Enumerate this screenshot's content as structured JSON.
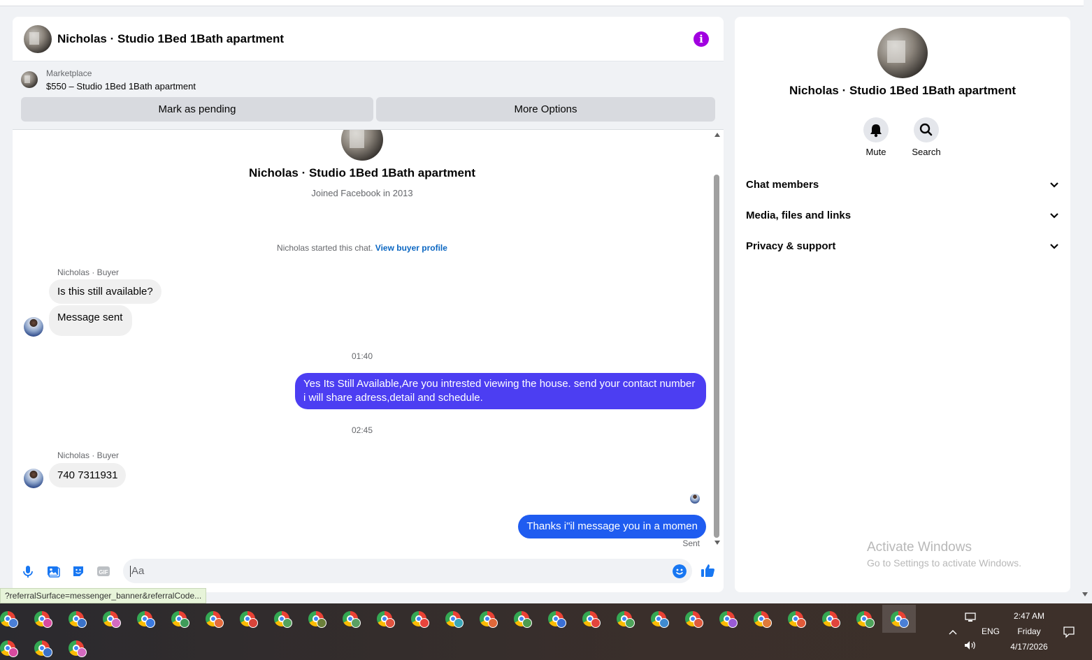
{
  "conversation": {
    "title": "Nicholas · Studio 1Bed 1Bath apartment",
    "info_icon": "info-icon"
  },
  "marketplace": {
    "label": "Marketplace",
    "listing": "$550 – Studio 1Bed 1Bath apartment",
    "mark_pending": "Mark as pending",
    "more_options": "More Options"
  },
  "profile": {
    "name": "Nicholas · Studio 1Bed 1Bath apartment",
    "joined": "Joined Facebook in 2013",
    "started_text": "Nicholas started this chat.",
    "view_profile": "View buyer profile"
  },
  "messages": [
    {
      "sender": "Nicholas · Buyer",
      "text": "Is this still available?",
      "dir": "in"
    },
    {
      "text": "Message sent",
      "dir": "in"
    },
    {
      "time": "01:40"
    },
    {
      "text": "Yes Its Still Available,Are you intrested viewing the house. send your contact number i will share adress,detail and schedule.",
      "dir": "out"
    },
    {
      "time": "02:45"
    },
    {
      "sender": "Nicholas · Buyer",
      "text": "740 7311931",
      "dir": "in"
    },
    {
      "text": "Thanks i\"il message you in a momen",
      "dir": "out",
      "status": "Sent"
    }
  ],
  "composer": {
    "placeholder": "Aa",
    "icons": [
      "microphone-icon",
      "photo-icon",
      "sticker-icon",
      "gif-icon",
      "emoji-icon",
      "thumbs-up-icon"
    ]
  },
  "status_url": "?referralSurface=messenger_banner&referralCode...",
  "side_panel": {
    "name": "Nicholas · Studio 1Bed 1Bath apartment",
    "mute": "Mute",
    "search": "Search",
    "sections": [
      "Chat members",
      "Media, files and links",
      "Privacy & support"
    ]
  },
  "watermark": {
    "title": "Activate Windows",
    "subtitle": "Go to Settings to activate Windows."
  },
  "taskbar": {
    "language": "ENG",
    "time": "2:47 AM",
    "day": "Friday",
    "date": "4/17/2026"
  },
  "colors": {
    "accent_purple": "#4c3ef2",
    "accent_blue": "#1f5cf0",
    "info": "#a100e0",
    "link": "#0a66c2"
  }
}
